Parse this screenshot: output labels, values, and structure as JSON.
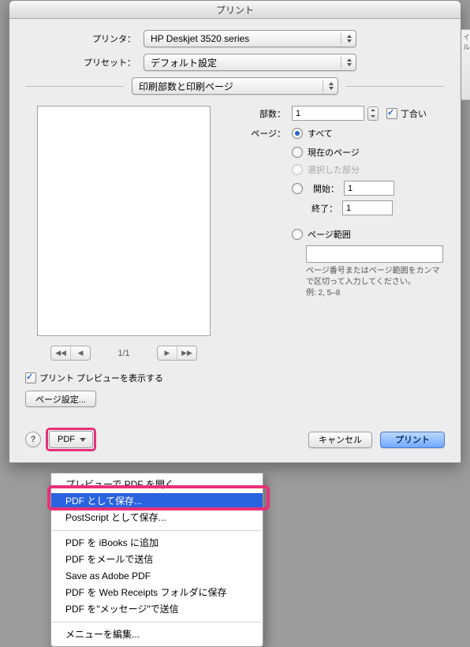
{
  "title": "プリント",
  "printer": {
    "label": "プリンタ：",
    "value": "HP Deskjet 3520 series"
  },
  "preset": {
    "label": "プリセット：",
    "value": "デフォルト設定"
  },
  "section_combo": "印刷部数と印刷ページ",
  "copies": {
    "label": "部数：",
    "value": "1",
    "collate_label": "丁合い"
  },
  "pages": {
    "label": "ページ：",
    "all": "すべて",
    "current": "現在のページ",
    "selection": "選択した部分",
    "from_label": "開始：",
    "from_value": "1",
    "to_label": "終了：",
    "to_value": "1",
    "range_label": "ページ範囲",
    "hint1": "ページ番号またはページ範囲をカンマで区切って入力してください。",
    "hint2": "例: 2, 5–8"
  },
  "pager": {
    "count": "1/1"
  },
  "show_preview": "プリント プレビューを表示する",
  "page_setup": "ページ設定...",
  "help": "?",
  "pdf_button": "PDF",
  "cancel": "キャンセル",
  "print": "プリント",
  "menu": {
    "open": "プレビューで PDF を開く",
    "save": "PDF として保存...",
    "postscript": "PostScript として保存...",
    "ibooks": "PDF を iBooks に追加",
    "mail": "PDF をメールで送信",
    "adobe": "Save as Adobe PDF",
    "receipts": "PDF を Web Receipts フォルダに保存",
    "message": "PDF を\"メッセージ\"で送信",
    "edit": "メニューを編集..."
  },
  "bg_tab": "イル"
}
